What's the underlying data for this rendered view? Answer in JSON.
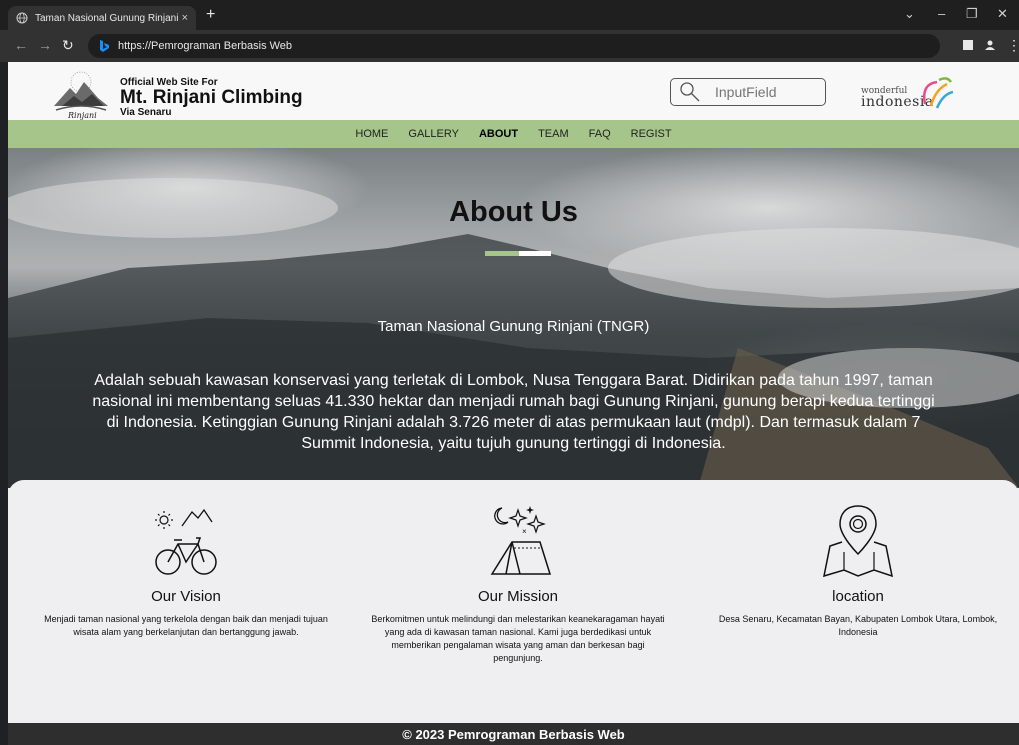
{
  "browser": {
    "tab_title": "Taman Nasional Gunung Rinjani",
    "tab_close": "×",
    "new_tab": "+",
    "url": "https://Pemrograman Berbasis Web"
  },
  "header": {
    "logo_text": "Rinjani",
    "brand_small": "Official Web Site For",
    "brand_big": "Mt. Rinjani Climbing",
    "brand_sub": "Via Senaru",
    "search_placeholder": "InputField",
    "partner_logo_line1": "wonderful",
    "partner_logo_line2": "indonesia"
  },
  "nav": {
    "items": [
      {
        "label": "HOME"
      },
      {
        "label": "GALLERY"
      },
      {
        "label": "ABOUT"
      },
      {
        "label": "TEAM"
      },
      {
        "label": "FAQ"
      },
      {
        "label": "REGIST"
      }
    ],
    "active": "ABOUT"
  },
  "hero": {
    "title": "About Us",
    "subtitle": "Taman Nasional Gunung Rinjani (TNGR)",
    "description": "Adalah sebuah kawasan konservasi yang terletak di Lombok, Nusa Tenggara Barat. Didirikan pada tahun 1997, taman nasional ini membentang seluas 41.330 hektar dan menjadi rumah bagi Gunung Rinjani, gunung berapi kedua tertinggi di Indonesia. Ketinggian Gunung Rinjani adalah 3.726 meter di atas permukaan laut (mdpl). Dan termasuk dalam 7 Summit Indonesia, yaitu tujuh gunung tertinggi di Indonesia.",
    "accent_color": "#a5c58a"
  },
  "features": [
    {
      "icon": "bicycle-sun-mountain-icon",
      "title": "Our Vision",
      "text": "Menjadi taman nasional yang terkelola dengan baik dan menjadi tujuan wisata alam yang berkelanjutan dan bertanggung jawab."
    },
    {
      "icon": "tent-moon-stars-icon",
      "title": "Our Mission",
      "text": "Berkomitmen untuk melindungi dan melestarikan keanekaragaman hayati yang ada di kawasan taman nasional. Kami juga berdedikasi untuk memberikan pengalaman wisata yang aman dan berkesan bagi pengunjung."
    },
    {
      "icon": "map-pin-icon",
      "title": "location",
      "text": "Desa Senaru, Kecamatan Bayan, Kabupaten Lombok Utara, Lombok, Indonesia"
    }
  ],
  "footer": {
    "text": "© 2023 Pemrograman Berbasis Web"
  }
}
